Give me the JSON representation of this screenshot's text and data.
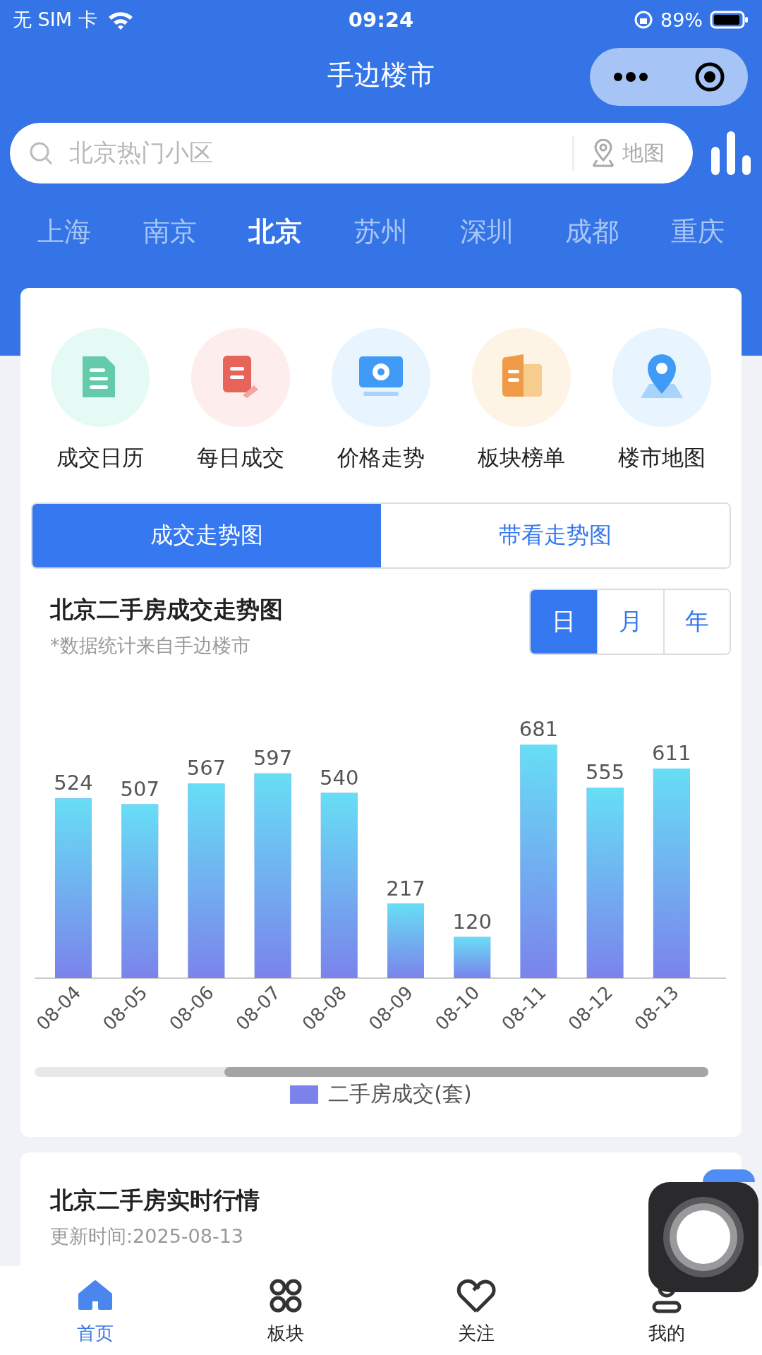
{
  "status_bar": {
    "carrier": "无 SIM 卡",
    "time": "09:24",
    "battery": "89%"
  },
  "nav": {
    "title": "手边楼市"
  },
  "search": {
    "placeholder": "北京热门小区",
    "map_label": "地图"
  },
  "cities": [
    {
      "label": "上海",
      "selected": false
    },
    {
      "label": "南京",
      "selected": false
    },
    {
      "label": "北京",
      "selected": true
    },
    {
      "label": "苏州",
      "selected": false
    },
    {
      "label": "深圳",
      "selected": false
    },
    {
      "label": "成都",
      "selected": false
    },
    {
      "label": "重庆",
      "selected": false
    }
  ],
  "shortcuts": [
    {
      "label": "成交日历",
      "kind": "calendar"
    },
    {
      "label": "每日成交",
      "kind": "daily"
    },
    {
      "label": "价格走势",
      "kind": "price"
    },
    {
      "label": "板块榜单",
      "kind": "board"
    },
    {
      "label": "楼市地图",
      "kind": "map"
    }
  ],
  "chart_tabs": [
    {
      "label": "成交走势图",
      "selected": true
    },
    {
      "label": "带看走势图",
      "selected": false
    }
  ],
  "trend": {
    "title": "北京二手房成交走势图",
    "subtitle": "*数据统计来自手边楼市",
    "periods": [
      {
        "label": "日",
        "selected": true
      },
      {
        "label": "月",
        "selected": false
      },
      {
        "label": "年",
        "selected": false
      }
    ],
    "chart_data": {
      "type": "bar",
      "categories": [
        "08-04",
        "08-05",
        "08-06",
        "08-07",
        "08-08",
        "08-09",
        "08-10",
        "08-11",
        "08-12",
        "08-13"
      ],
      "series": [
        {
          "name": "二手房成交(套)",
          "color": "#7b83eb",
          "values": [
            524,
            507,
            567,
            597,
            540,
            217,
            120,
            681,
            555,
            611
          ]
        }
      ],
      "data_labels": true
    }
  },
  "realtime": {
    "title": "北京二手房实时行情",
    "subtitle": "更新时间:2025-08-13"
  },
  "tab_bar": [
    {
      "label": "首页",
      "kind": "home",
      "selected": true
    },
    {
      "label": "板块",
      "kind": "grid",
      "selected": false
    },
    {
      "label": "关注",
      "kind": "heart",
      "selected": false
    },
    {
      "label": "我的",
      "kind": "user",
      "selected": false
    }
  ]
}
